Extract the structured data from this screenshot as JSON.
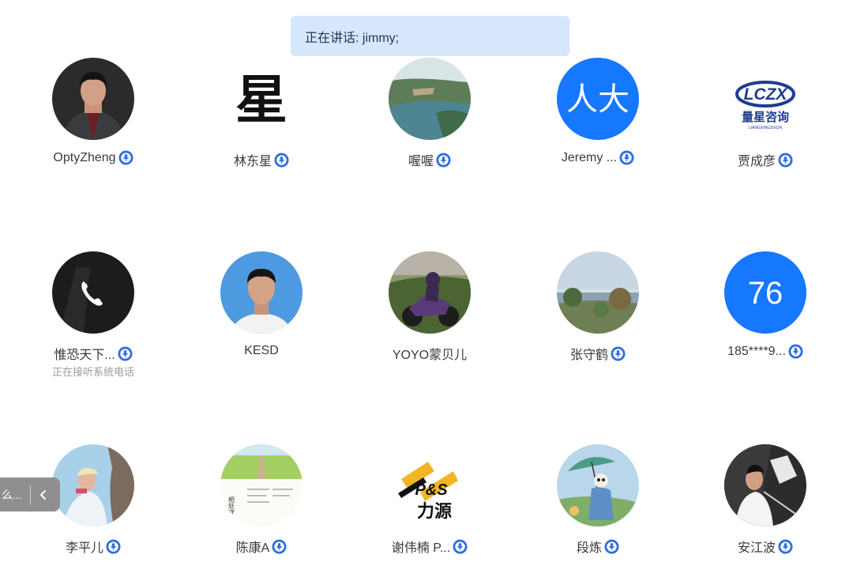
{
  "banner": {
    "text": "正在讲话: jimmy;"
  },
  "colors": {
    "accent": "#1677ff",
    "banner_bg": "#d6e6fb",
    "mic_badge": "#2f6fe0"
  },
  "participants": [
    {
      "name": "OptyZheng",
      "avatar": "photo-man-suit",
      "mic": true
    },
    {
      "name": "林东星",
      "avatar": "calligraphy-xing",
      "mic": true
    },
    {
      "name": "喔喔",
      "avatar": "landscape-lake",
      "mic": true
    },
    {
      "name": "Jeremy ...",
      "avatar_text": "人大",
      "avatar": "initials-blue",
      "mic": true
    },
    {
      "name": "贾成彦",
      "avatar": "logo-lczx",
      "mic": true
    },
    {
      "name": "惟恐天下...",
      "status": "正在接听系统电话",
      "avatar": "phone-icon",
      "mic": true
    },
    {
      "name": "KESD",
      "avatar": "photo-man-blue",
      "mic": false
    },
    {
      "name": "YOYO蒙贝儿",
      "avatar": "photo-motorbike",
      "mic": false
    },
    {
      "name": "张守鹤",
      "avatar": "landscape-coast",
      "mic": true
    },
    {
      "name": "185****9...",
      "avatar_text": "76",
      "avatar": "initials-blue",
      "mic": true
    },
    {
      "name": "李平儿",
      "avatar": "photo-woman-rock",
      "mic": true
    },
    {
      "name": "陈康A",
      "avatar": "card-field-road",
      "avatar_card_text": "相处守",
      "mic": true
    },
    {
      "name": "谢伟楠 P...",
      "avatar": "logo-ps-liyuan",
      "mic": true
    },
    {
      "name": "段炼",
      "avatar": "painting-umbrella",
      "mic": true
    },
    {
      "name": "安江波",
      "avatar": "photo-fencing",
      "mic": true
    }
  ],
  "side_tab": {
    "label": "么...",
    "icon": "chevron-left-icon"
  },
  "logos": {
    "lczx_top": "LCZX",
    "lczx_cn": "量星咨询",
    "lczx_en": "LIANGXINGZIXUN",
    "ps": "P&S",
    "liyuan": "力源",
    "calligraphy": "星"
  }
}
